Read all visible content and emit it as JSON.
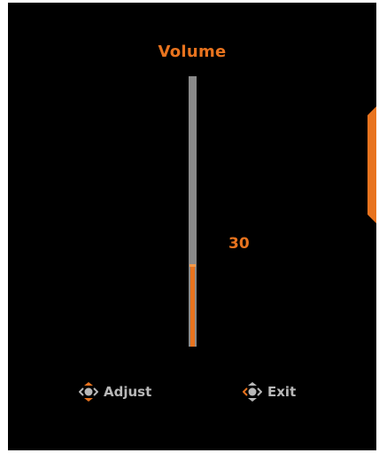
{
  "menu": {
    "title": "Volume",
    "value": "30",
    "level_percent": 30
  },
  "hints": {
    "adjust": {
      "label": "Adjust",
      "icon": "joystick-up-down-icon"
    },
    "exit": {
      "label": "Exit",
      "icon": "joystick-left-icon"
    }
  },
  "colors": {
    "accent": "#e8731e",
    "track": "#8a8a8a",
    "hint_text": "#b8b8b8",
    "background": "#000000"
  }
}
